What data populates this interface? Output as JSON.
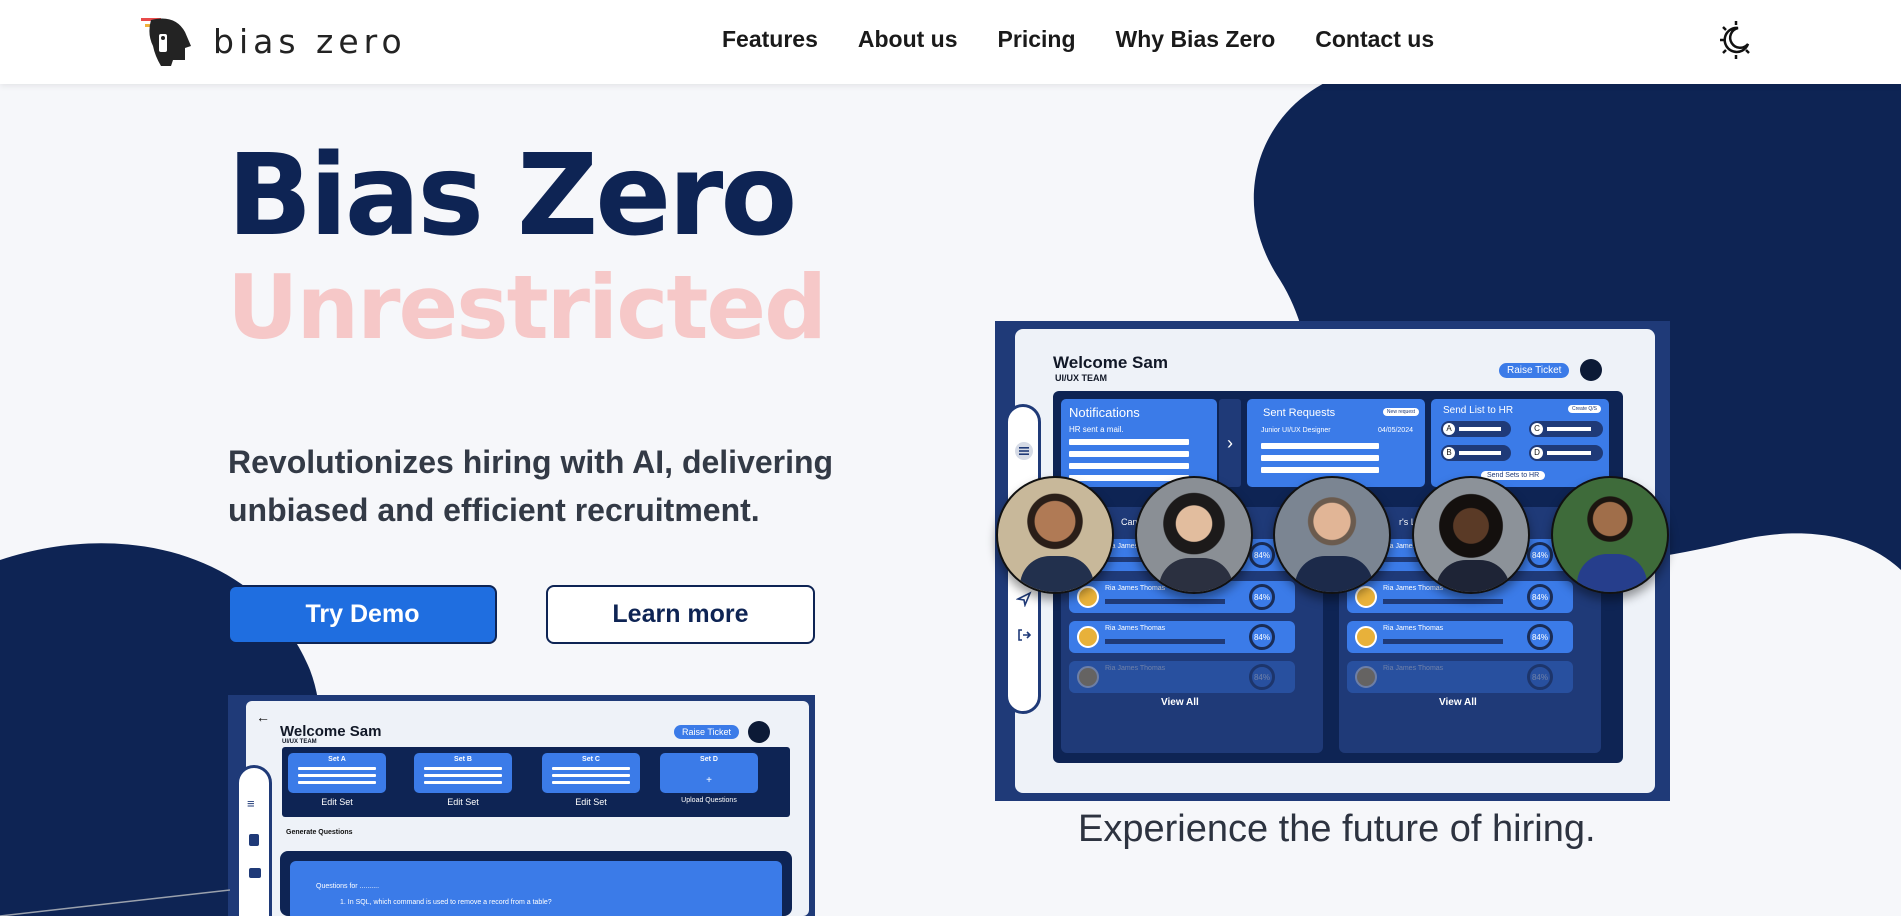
{
  "brand": {
    "name": "bias zero",
    "colors": {
      "navy": "#0e2454",
      "accent": "#1f6ee0",
      "pink": "#f6c8c8"
    }
  },
  "nav": {
    "links": [
      "Features",
      "About us",
      "Pricing",
      "Why Bias Zero",
      "Contact us"
    ],
    "theme_icon": "moon-sun-icon"
  },
  "hero": {
    "title": "Bias Zero",
    "subtitle": "Unrestricted",
    "description": "Revolutionizes hiring with AI, delivering unbiased and efficient recruitment.",
    "primary_cta": "Try Demo",
    "secondary_cta": "Learn more"
  },
  "dashboard_right": {
    "welcome": "Welcome Sam",
    "team": "UI/UX TEAM",
    "raise_ticket": "Raise Ticket",
    "notifications": {
      "title": "Notifications",
      "text": "HR sent a mail."
    },
    "sent_requests": {
      "title": "Sent Requests",
      "badge": "New request",
      "role": "Junior UI/UX Designer",
      "date": "04/05/2024"
    },
    "send_list": {
      "title": "Send List to HR",
      "badge": "Create Q/S",
      "options": [
        "A",
        "B",
        "C",
        "D"
      ],
      "action": "Send Sets to HR"
    },
    "left_heading_fragment": "Can",
    "right_heading_fragment": "r's Lis",
    "candidate_name": "Ria James Thomas",
    "score": "84%",
    "view_all": "View All"
  },
  "caption": "Experience the future of hiring.",
  "dashboard_left": {
    "welcome": "Welcome Sam",
    "team": "UI/UX TEAM",
    "raise_ticket": "Raise Ticket",
    "sets": [
      {
        "label": "Set A",
        "action": "Edit Set"
      },
      {
        "label": "Set B",
        "action": "Edit Set"
      },
      {
        "label": "Set C",
        "action": "Edit Set"
      },
      {
        "label": "Set D",
        "action": "Upload Questions"
      }
    ],
    "generate_label": "Generate Questions",
    "questions_for": "Questions for ..........",
    "question_1": "1. In SQL, which command is used to remove a record from a table?"
  }
}
